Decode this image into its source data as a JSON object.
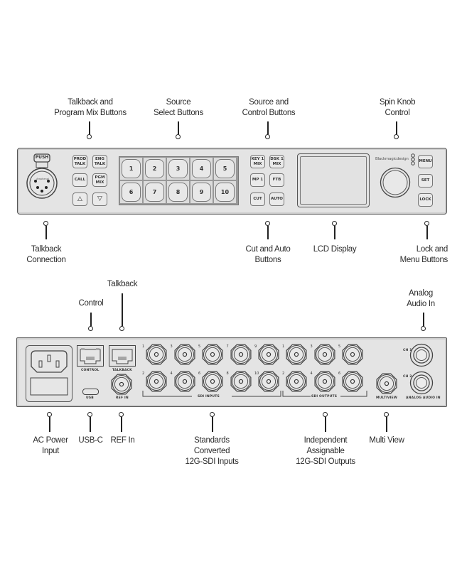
{
  "front_panel": {
    "callouts_top": [
      {
        "id": "talkback-program-mix",
        "text": "Talkback and\nProgram Mix Buttons"
      },
      {
        "id": "source-select",
        "text": "Source\nSelect Buttons"
      },
      {
        "id": "source-control",
        "text": "Source and\nControl  Buttons"
      },
      {
        "id": "spin-knob",
        "text": "Spin Knob\nControl"
      }
    ],
    "callouts_bottom": [
      {
        "id": "talkback-connection",
        "text": "Talkback\nConnection"
      },
      {
        "id": "cut-auto",
        "text": "Cut and Auto\nButtons"
      },
      {
        "id": "lcd-display",
        "text": "LCD Display"
      },
      {
        "id": "lock-menu",
        "text": "Lock and\nMenu Buttons"
      }
    ],
    "xlr": {
      "push_label": "PUSH",
      "brand": "Amphenol",
      "pins": [
        "1",
        "2",
        "3",
        "4",
        "5"
      ]
    },
    "talkback_buttons": [
      "PROD\nTALK",
      "ENG\nTALK",
      "CALL",
      "PGM\nMIX",
      "△",
      "▽"
    ],
    "source_buttons": [
      "1",
      "2",
      "3",
      "4",
      "5",
      "6",
      "7",
      "8",
      "9",
      "10"
    ],
    "control_buttons": [
      "KEY 1\nMIX",
      "DSK 1\nMIX",
      "MP 1",
      "FTB",
      "CUT",
      "AUTO"
    ],
    "brand": "Blackmagicdesign",
    "menu_buttons": [
      "MENU",
      "SET",
      "LOCK"
    ]
  },
  "rear_panel": {
    "callouts_top": [
      {
        "id": "control",
        "text": "Control"
      },
      {
        "id": "talkback",
        "text": "Talkback"
      },
      {
        "id": "analog-audio-in",
        "text": "Analog\nAudio In"
      }
    ],
    "callouts_bottom": [
      {
        "id": "ac-power",
        "text": "AC Power\nInput"
      },
      {
        "id": "usb-c",
        "text": "USB-C"
      },
      {
        "id": "ref-in",
        "text": "REF In"
      },
      {
        "id": "sdi-inputs",
        "text": "Standards\nConverted\n12G-SDI Inputs"
      },
      {
        "id": "sdi-outputs",
        "text": "Independent\nAssignable\n12G-SDI Outputs"
      },
      {
        "id": "multi-view",
        "text": "Multi View"
      }
    ],
    "port_labels": {
      "control": "CONTROL",
      "talkback": "TALKBACK",
      "usb": "USB",
      "ref_in": "REF IN",
      "sdi_inputs": "SDI INPUTS",
      "sdi_outputs": "SDI OUTPUTS",
      "multiview": "MULTIVIEW",
      "analog_audio_in": "ANALOG AUDIO IN",
      "ch1": "CH 1",
      "ch2": "CH 2"
    },
    "sdi_input_numbers": [
      "1",
      "3",
      "5",
      "7",
      "9",
      "2",
      "4",
      "6",
      "8",
      "10"
    ],
    "sdi_output_numbers": [
      "1",
      "3",
      "5",
      "2",
      "4",
      "6"
    ]
  }
}
